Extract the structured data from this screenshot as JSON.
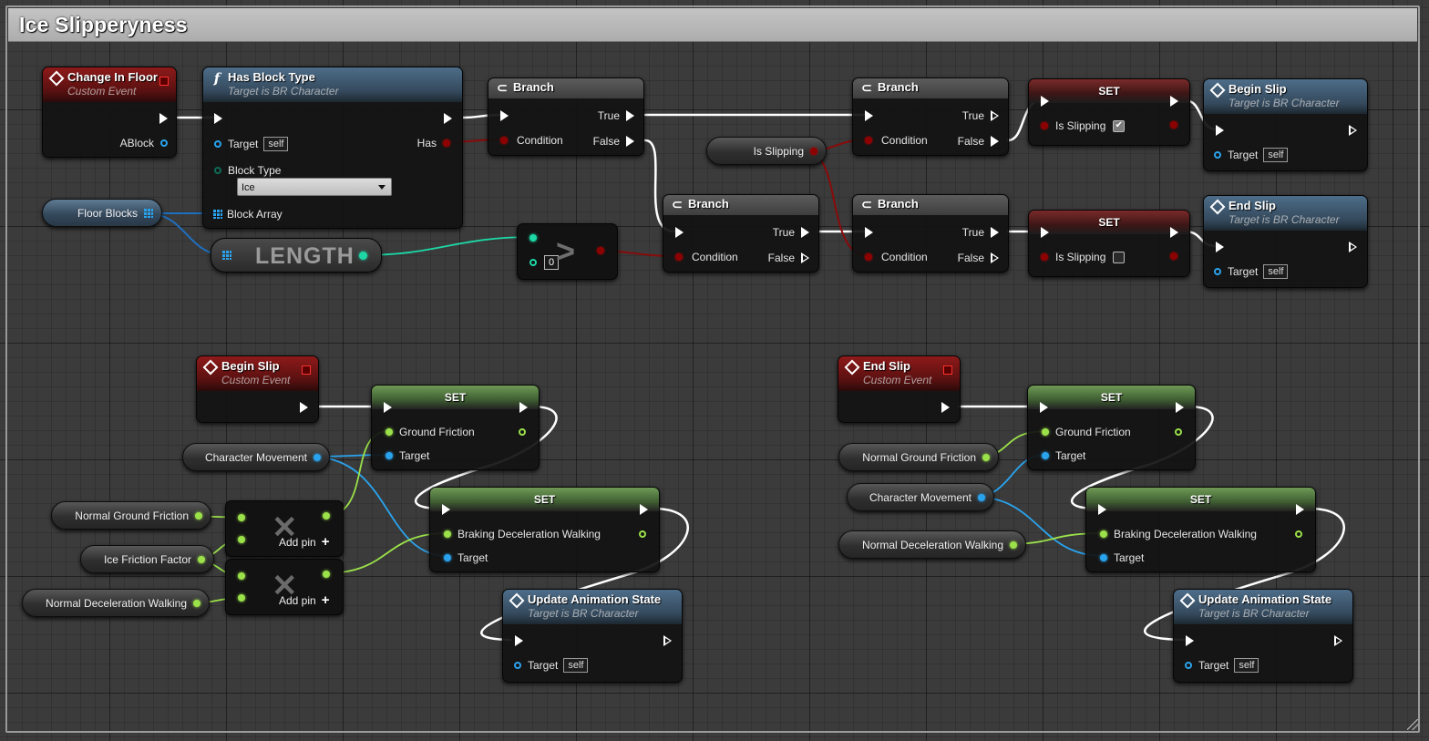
{
  "comment": {
    "title": "Ice Slipperyness"
  },
  "nodes": {
    "change_in_floor": {
      "title": "Change In Floor",
      "subtitle": "Custom Event",
      "out_pin": "ABlock"
    },
    "has_block_type": {
      "title": "Has Block Type",
      "subtitle": "Target is BR Character",
      "target": "Target",
      "self": "self",
      "block_type": "Block Type",
      "block_type_value": "Ice",
      "block_array": "Block Array",
      "has": "Has"
    },
    "branch_1": {
      "title": "Branch",
      "condition": "Condition",
      "true": "True",
      "false": "False"
    },
    "branch_2": {
      "title": "Branch",
      "condition": "Condition",
      "true": "True",
      "false": "False"
    },
    "branch_3": {
      "title": "Branch",
      "condition": "Condition",
      "true": "True",
      "false": "False"
    },
    "branch_4": {
      "title": "Branch",
      "condition": "Condition",
      "true": "True",
      "false": "False"
    },
    "set_slipping_true": {
      "title": "SET",
      "pin": "Is Slipping",
      "checked": "✔"
    },
    "set_slipping_false": {
      "title": "SET",
      "pin": "Is Slipping"
    },
    "begin_slip_call": {
      "title": "Begin Slip",
      "subtitle": "Target is BR Character",
      "target": "Target",
      "self": "self"
    },
    "end_slip_call": {
      "title": "End Slip",
      "subtitle": "Target is BR Character",
      "target": "Target",
      "self": "self"
    },
    "length": {
      "title": "LENGTH"
    },
    "greater": {
      "symbol": ">",
      "value": "0"
    },
    "begin_slip_event": {
      "title": "Begin Slip",
      "subtitle": "Custom Event"
    },
    "end_slip_event": {
      "title": "End Slip",
      "subtitle": "Custom Event"
    },
    "set_gf_left": {
      "title": "SET",
      "pin": "Ground Friction",
      "target": "Target"
    },
    "set_bd_left": {
      "title": "SET",
      "pin": "Braking Deceleration Walking",
      "target": "Target"
    },
    "set_gf_right": {
      "title": "SET",
      "pin": "Ground Friction",
      "target": "Target"
    },
    "set_bd_right": {
      "title": "SET",
      "pin": "Braking Deceleration Walking",
      "target": "Target"
    },
    "uas_left": {
      "title": "Update Animation State",
      "subtitle": "Target is BR Character",
      "target": "Target",
      "self": "self"
    },
    "uas_right": {
      "title": "Update Animation State",
      "subtitle": "Target is BR Character",
      "target": "Target",
      "self": "self"
    },
    "multiply_1": {
      "add_pin": "Add pin"
    },
    "multiply_2": {
      "add_pin": "Add pin"
    }
  },
  "variables": {
    "is_slipping": "Is Slipping",
    "floor_blocks": "Floor Blocks",
    "character_movement_left": "Character Movement",
    "normal_ground_friction_left": "Normal Ground Friction",
    "ice_friction_factor": "Ice Friction Factor",
    "normal_deceleration_walking_left": "Normal Deceleration Walking",
    "normal_ground_friction_right": "Normal Ground Friction",
    "character_movement_right": "Character Movement",
    "normal_deceleration_walking_right": "Normal Deceleration Walking"
  },
  "colors": {
    "exec": "#ffffff",
    "bool": "#8c0202",
    "object": "#2aa3ee",
    "float": "#9be14a",
    "int": "#1dd8a6",
    "event_header": "#8e1a1a",
    "function_header": "#4d6d89",
    "set_header": "#6f9a56"
  }
}
